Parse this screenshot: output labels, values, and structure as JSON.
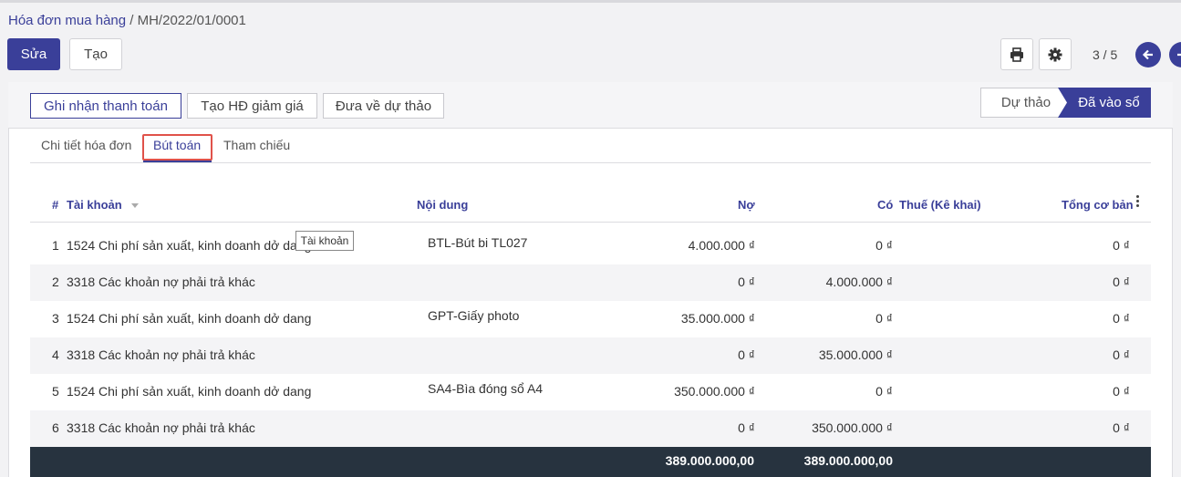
{
  "breadcrumb": {
    "parent": "Hóa đơn mua hàng",
    "separator": "/",
    "current": "MH/2022/01/0001"
  },
  "control": {
    "edit_label": "Sửa",
    "create_label": "Tạo",
    "pager": "3 / 5"
  },
  "actions": {
    "register_payment": "Ghi nhận thanh toán",
    "create_discount": "Tạo HĐ giảm giá",
    "reset_draft": "Đưa về dự thảo"
  },
  "status": {
    "draft": "Dự thảo",
    "posted": "Đã vào sổ"
  },
  "tabs": [
    "Chi tiết hóa đơn",
    "Bút toán",
    "Tham chiếu"
  ],
  "table": {
    "headers": {
      "index": "#",
      "account": "Tài khoản",
      "label": "Nội dung",
      "debit": "Nợ",
      "credit": "Có",
      "tax": "Thuế (Kê khai)",
      "balance": "Tổng cơ bản"
    },
    "rows": [
      {
        "index": "1",
        "account": "1524 Chi phí sản xuất, kinh doanh dở dang",
        "label": "BTL-Bút bi TL027",
        "debit": "4.000.000 ₫",
        "credit": "0 ₫",
        "balance": "0 ₫"
      },
      {
        "index": "2",
        "account": "3318 Các khoản nợ phải trả khác",
        "label": "",
        "debit": "0 ₫",
        "credit": "4.000.000 ₫",
        "balance": "0 ₫"
      },
      {
        "index": "3",
        "account": "1524 Chi phí sản xuất, kinh doanh dở dang",
        "label": "GPT-Giấy photo",
        "debit": "35.000.000 ₫",
        "credit": "0 ₫",
        "balance": "0 ₫"
      },
      {
        "index": "4",
        "account": "3318 Các khoản nợ phải trả khác",
        "label": "",
        "debit": "0 ₫",
        "credit": "35.000.000 ₫",
        "balance": "0 ₫"
      },
      {
        "index": "5",
        "account": "1524 Chi phí sản xuất, kinh doanh dở dang",
        "label": "SA4-Bìa đóng sổ A4",
        "debit": "350.000.000 ₫",
        "credit": "0 ₫",
        "balance": "0 ₫"
      },
      {
        "index": "6",
        "account": "3318 Các khoản nợ phải trả khác",
        "label": "",
        "debit": "0 ₫",
        "credit": "350.000.000 ₫",
        "balance": "0 ₫"
      }
    ],
    "totals": {
      "debit": "389.000.000,00",
      "credit": "389.000.000,00"
    }
  },
  "tooltip": "Tài khoản",
  "colors": {
    "accent": "#3a3f99",
    "footer": "#27333f",
    "highlight": "#e0524a"
  }
}
